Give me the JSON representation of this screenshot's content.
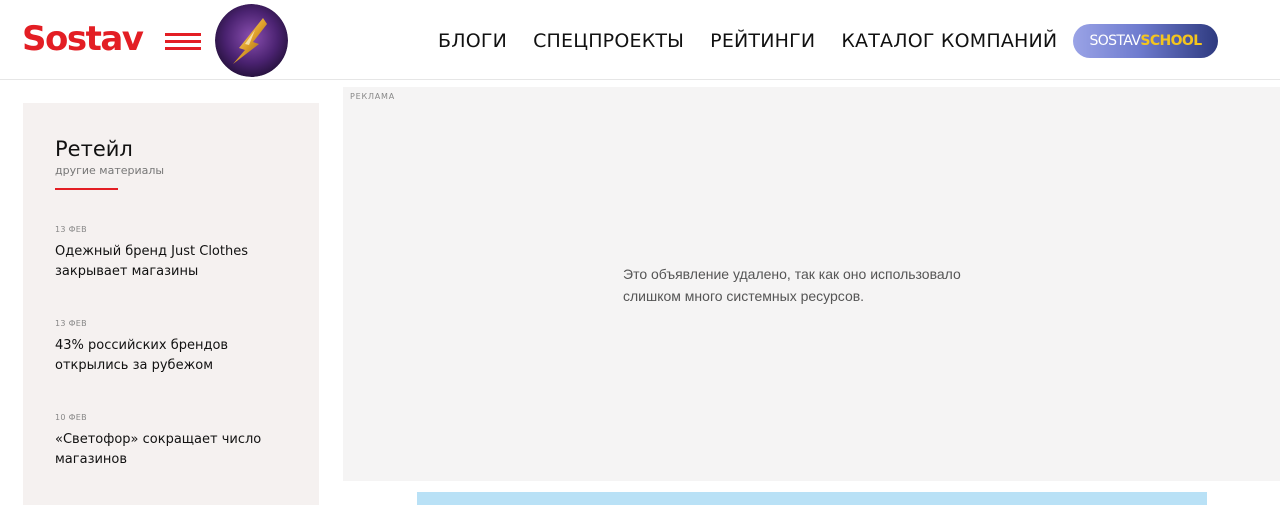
{
  "header": {
    "logo": "Sostav",
    "nav": [
      "БЛОГИ",
      "СПЕЦПРОЕКТЫ",
      "РЕЙТИНГИ",
      "КАТАЛОГ КОМПАНИЙ"
    ],
    "school": {
      "part1": "SOSTAV",
      "part2": "SCHOOL"
    }
  },
  "sidebar": {
    "title": "Ретейл",
    "subtitle": "другие материалы",
    "items": [
      {
        "date": "13 ФЕВ",
        "title": "Одежный бренд Just Clothes закрывает магазины"
      },
      {
        "date": "13 ФЕВ",
        "title": "43% российских брендов открылись за рубежом"
      },
      {
        "date": "10 ФЕВ",
        "title": "«Светофор» сокращает число магазинов"
      }
    ]
  },
  "ad": {
    "label": "РЕКЛАМА",
    "message": "Это объявление удалено, так как оно использовало слишком много системных ресурсов."
  },
  "colors": {
    "accent": "#e31e24",
    "sidebar_bg": "#f5f1f0",
    "ad_bg": "#f5f4f4",
    "banner": "#b9e1f6"
  }
}
